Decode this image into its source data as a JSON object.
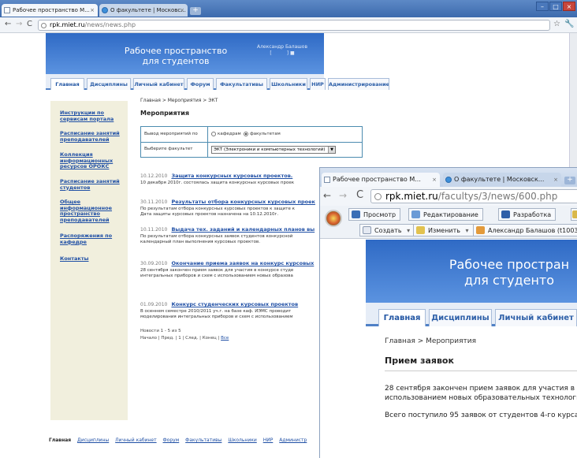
{
  "window1": {
    "tabs": [
      {
        "label": "Рабочее пространство М..."
      },
      {
        "label": "О факультете | Московс..."
      }
    ],
    "address": {
      "host": "rpk.miet.ru",
      "path": "/news/news.php"
    },
    "site": {
      "brand_line1": "Рабочее пространство",
      "brand_line2": "для студентов",
      "user_name": "Александр Балашов",
      "nav": [
        "Главная",
        "Дисциплины",
        "Личный кабинет",
        "Форум",
        "Факультативы",
        "Школьники",
        "НИР",
        "Администрирование"
      ],
      "sidebar": [
        "Инструкции по сервисам портала",
        "Расписание занятий преподавателей",
        "Коллекция информационных ресурсов ОРОКС",
        "Расписание занятий студентов",
        "Общее информационное пространство преподавателей",
        "Распоряжения по кафедре",
        "Контакты"
      ],
      "breadcrumb": "Главная > Мероприятия > ЭКТ",
      "heading": "Мероприятия",
      "filter": {
        "output_label": "Вывод мероприятий по",
        "radio_dept": "кафедрам",
        "radio_faculty": "факультетам",
        "faculty_label": "Выберите факультет",
        "faculty_value": "ЭКТ (Электроники и компьютерных технологий)"
      },
      "news": [
        {
          "date": "10.12.2010",
          "title": "Защита конкурсных курсовых проектов.",
          "desc": [
            "10 декабря 2010г. состоялась защита конкурсных курсовых проек"
          ]
        },
        {
          "date": "30.11.2010",
          "title": "Результаты отбора конкурсных курсовых проек",
          "desc": [
            "По результатам отбора конкурсных курсовых проектов к защите к",
            "Дата защиты курсовых проектов назначена на 10.12.2010г."
          ]
        },
        {
          "date": "10.11.2010",
          "title": "Выдача тех. заданий и календарных планов вы",
          "desc": [
            "По результатам отбора конкурсных заявок студентов конкурсной",
            "календарный план выполнения курсовых проектов."
          ]
        },
        {
          "date": "30.09.2010",
          "title": "Окончание приема заявок на конкурс курсовых",
          "desc": [
            "28 сентября закончен прием заявок для участия в конкурсе студе",
            "интегральных приборов и схем с использованием новых образова"
          ]
        },
        {
          "date": "01.09.2010",
          "title": "Конкурс студенческих курсовых проектов",
          "desc": [
            "В осеннем семестре 2010/2011 уч.г. на базе каф. ИЭМС проводит",
            "моделирования интегральных приборов и схем с использованием"
          ]
        }
      ],
      "pager_count": "Новости 1 - 5 из 5",
      "pager_nav": "Начало | Пред. | 1 | След. | Конец |",
      "pager_all": "Все",
      "footer": [
        "Главная",
        "Дисциплины",
        "Личный кабинет",
        "Форум",
        "Факультативы",
        "Школьники",
        "НИР",
        "Администр"
      ]
    }
  },
  "window2": {
    "tabs": [
      {
        "label": "Рабочее пространство М..."
      },
      {
        "label": "О факультете | Московск..."
      }
    ],
    "address": {
      "host": "rpk.miet.ru",
      "path": "/facultys/3/news/600.php"
    },
    "bookmarks_row1": [
      "Просмотр",
      "Редактирование",
      "Разработка"
    ],
    "bookmarks_row2": [
      "Создать",
      "Изменить",
      "Александр Балашов (t10036"
    ],
    "site": {
      "brand_line1": "Рабочее простран",
      "brand_line2": "для студенто",
      "nav": [
        "Главная",
        "Дисциплины",
        "Личный кабинет"
      ],
      "breadcrumb": "Главная > Мероприятия",
      "heading": "Прием заявок",
      "para1_line1": "28 сентября закончен прием заявок для участия в",
      "para1_line2": "использованием новых образовательных технологи",
      "para2": "Всего поступило 95 заявок от студентов 4-го курса"
    }
  }
}
